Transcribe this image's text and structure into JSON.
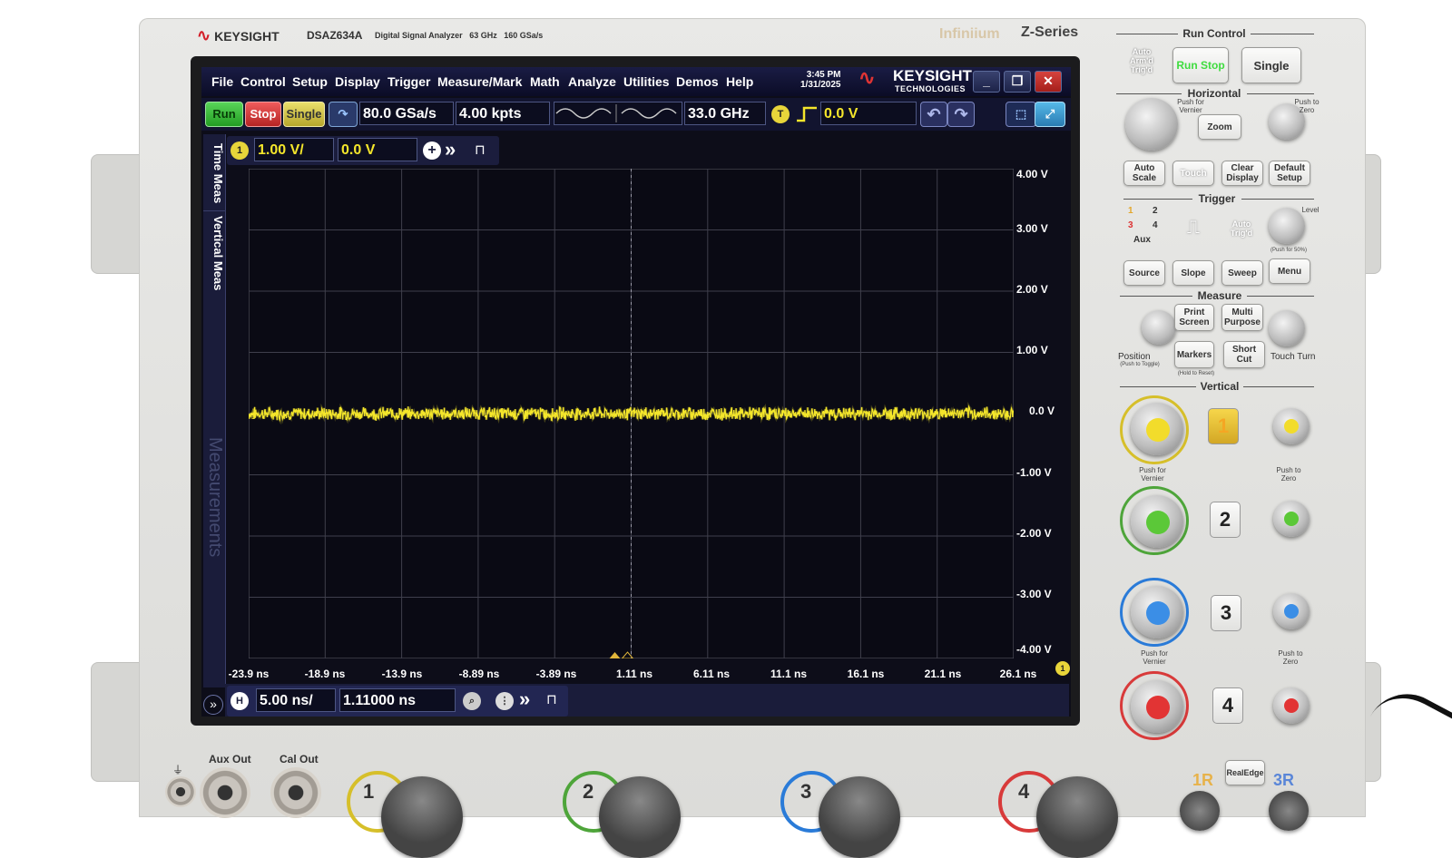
{
  "instrument": {
    "brand": "KEYSIGHT",
    "model": "DSAZ634A",
    "description": "Digital Signal Analyzer",
    "bandwidth": "63 GHz",
    "sample_rate_max": "160 GSa/s",
    "series_logo": "Infiniium",
    "series": "Z-Series"
  },
  "screen": {
    "menu": [
      "File",
      "Control",
      "Setup",
      "Display",
      "Trigger",
      "Measure/Mark",
      "Math",
      "Analyze",
      "Utilities",
      "Demos",
      "Help"
    ],
    "clock_time": "3:45 PM",
    "clock_date": "1/31/2025",
    "logo_main": "KEYSIGHT",
    "logo_sub": "TECHNOLOGIES",
    "window_buttons": {
      "minimize": "_",
      "restore": "❐",
      "close": "✕"
    },
    "toolbar": {
      "run": "Run",
      "stop": "Stop",
      "single": "Single",
      "sample_rate": "80.0 GSa/s",
      "memory_depth": "4.00 kpts",
      "bandwidth": "33.0 GHz",
      "trigger_badge": "T",
      "trigger_level": "0.0 V"
    },
    "side_tabs": [
      "Time Meas",
      "Vertical Meas",
      "Measurements"
    ],
    "channel_bar": {
      "channel": "1",
      "scale": "1.00 V/",
      "offset": "0.0 V"
    },
    "horizontal_bar": {
      "badge": "H",
      "scale": "5.00 ns/",
      "position": "1.11000 ns"
    },
    "expand_glyph": "»",
    "accent_colors": {
      "channel1": "#f5e62b",
      "run": "#35b535",
      "stop": "#d63a3a",
      "single": "#d6c744",
      "background": "#0a0a14"
    }
  },
  "chart_data": {
    "type": "line",
    "series": [
      {
        "values": "noise around 0.0 V, approx ±0.1 V"
      }
    ],
    "ylim": [
      -4,
      4
    ],
    "xlim": [
      -23.9,
      26.1
    ],
    "y_ticks": [
      "4.00 V",
      "3.00 V",
      "2.00 V",
      "1.00 V",
      "0.0 V",
      "-1.00 V",
      "-2.00 V",
      "-3.00 V",
      "-4.00 V"
    ],
    "x_ticks": [
      "-23.9 ns",
      "-18.9 ns",
      "-13.9 ns",
      "-8.89 ns",
      "-3.89 ns",
      "1.11 ns",
      "6.11 ns",
      "11.1 ns",
      "16.1 ns",
      "21.1 ns",
      "26.1 ns"
    ],
    "grid": true,
    "trace_color": "#f5e62b"
  },
  "front_panel": {
    "run_control": {
      "title": "Run Control",
      "auto_armd_trigd": "Auto Arm'd Trig'd",
      "run_stop": "Run Stop",
      "single": "Single"
    },
    "horizontal": {
      "title": "Horizontal",
      "zoom": "Zoom",
      "push_vernier": "Push for Vernier",
      "push_zero": "Push to Zero",
      "auto_scale": "Auto Scale",
      "touch": "Touch",
      "clear_display": "Clear Display",
      "default_setup": "Default Setup"
    },
    "trigger": {
      "title": "Trigger",
      "sources": [
        "1",
        "2",
        "3",
        "4"
      ],
      "aux": "Aux",
      "auto": "Auto Trig'd",
      "level": "Level",
      "push_50": "(Push for 50%)",
      "source": "Source",
      "slope": "Slope",
      "sweep": "Sweep",
      "menu": "Menu"
    },
    "measure": {
      "title": "Measure",
      "print_screen": "Print Screen",
      "multi_purpose": "Multi Purpose",
      "markers": "Markers",
      "short_cut": "Short Cut",
      "position": "Position",
      "position_hint": "(Push to Toggle)",
      "hold_reset": "(Hold to Reset)",
      "touch_turn": "Touch Turn"
    },
    "vertical": {
      "title": "Vertical",
      "channels": [
        "1",
        "2",
        "3",
        "4"
      ],
      "push_vernier": "Push for Vernier",
      "push_zero": "Push to Zero"
    },
    "bottom": {
      "aux_out": "Aux Out",
      "cal_out": "Cal Out",
      "inputs": [
        "1",
        "2",
        "3",
        "4"
      ],
      "realedge": "RealEdge",
      "r1": "1R",
      "r3": "3R"
    }
  }
}
